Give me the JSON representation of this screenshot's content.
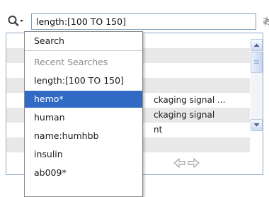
{
  "search": {
    "query": "length:[100 TO 150]",
    "clear_glyph": "≹"
  },
  "results": {
    "rows": [
      {
        "text": ""
      },
      {
        "text": ""
      },
      {
        "text": ""
      },
      {
        "text": ""
      },
      {
        "text": "ckaging signal ..."
      },
      {
        "text": "ckaging signal"
      },
      {
        "text": "nt"
      },
      {
        "text": ""
      }
    ]
  },
  "dropdown": {
    "search_label": "Search",
    "recent_header": "Recent Searches",
    "recent_items": [
      {
        "label": "length:[100 TO 150]",
        "selected": false
      },
      {
        "label": "hemo*",
        "selected": true
      },
      {
        "label": "human",
        "selected": false
      },
      {
        "label": "name:humhbb",
        "selected": false
      },
      {
        "label": "insulin",
        "selected": false
      },
      {
        "label": "ab009*",
        "selected": false
      }
    ]
  },
  "icons": {
    "search_menu": "search-icon",
    "dropdown_caret": "caret-down-icon",
    "clear": "clear-icon",
    "scroll_up": "scroll-up-icon",
    "scroll_down": "scroll-down-icon",
    "back": "back-arrow-icon",
    "forward": "forward-arrow-icon"
  },
  "colors": {
    "selection": "#316ac5",
    "input_border": "#7f9db9",
    "alt_row": "#e8e8e8"
  }
}
